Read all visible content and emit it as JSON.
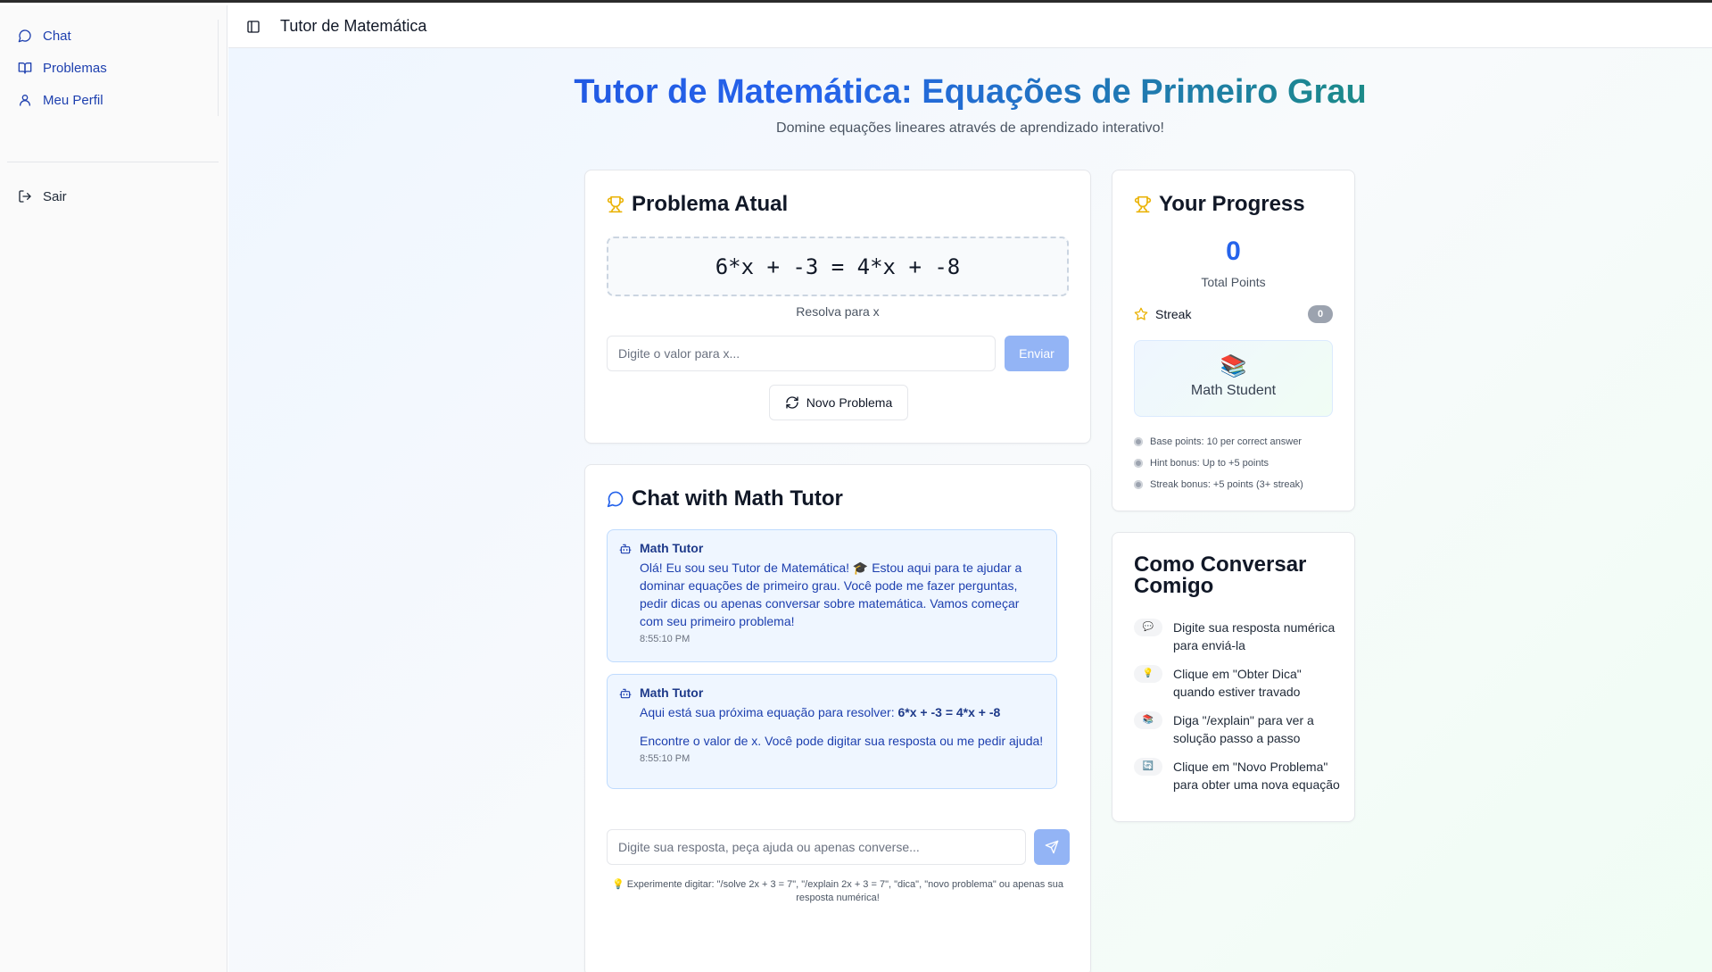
{
  "sidebar": {
    "items": [
      {
        "label": "Chat",
        "icon": "chat-bubble-icon"
      },
      {
        "label": "Problemas",
        "icon": "book-icon"
      },
      {
        "label": "Meu Perfil",
        "icon": "user-icon"
      }
    ],
    "logout": {
      "label": "Sair",
      "icon": "logout-icon"
    }
  },
  "header": {
    "title": "Tutor de Matemática"
  },
  "page": {
    "title": "Tutor de Matemática: Equações de Primeiro Grau",
    "subtitle": "Domine equações lineares através de aprendizado interativo!"
  },
  "problem": {
    "title": "Problema Atual",
    "equation": "6*x + -3 = 4*x + -8",
    "solve_for": "Resolva para x",
    "input_placeholder": "Digite o valor para x...",
    "send_label": "Enviar",
    "new_problem_label": "Novo Problema"
  },
  "chat": {
    "title": "Chat with Math Tutor",
    "messages": [
      {
        "sender": "Math Tutor",
        "text": "Olá! Eu sou seu Tutor de Matemática! 🎓 Estou aqui para te ajudar a dominar equações de primeiro grau. Você pode me fazer perguntas, pedir dicas ou apenas conversar sobre matemática. Vamos começar com seu primeiro problema!",
        "time": "8:55:10 PM"
      },
      {
        "sender": "Math Tutor",
        "text_prefix": "Aqui está sua próxima equação para resolver: ",
        "text_bold": "6*x + -3 = 4*x + -8",
        "text_line2": "Encontre o valor de x. Você pode digitar sua resposta ou me pedir ajuda!",
        "time": "8:55:10 PM"
      }
    ],
    "input_placeholder": "Digite sua resposta, peça ajuda ou apenas converse...",
    "tip": "💡 Experimente digitar: \"/solve 2x + 3 = 7\", \"/explain 2x + 3 = 7\", \"dica\", \"novo problema\" ou apenas sua resposta numérica!"
  },
  "progress": {
    "title": "Your Progress",
    "points": "0",
    "points_label": "Total Points",
    "streak_label": "Streak",
    "streak_value": "0",
    "level_emoji": "📚",
    "level_name": "Math Student",
    "rules": [
      "Base points: 10 per correct answer",
      "Hint bonus: Up to +5 points",
      "Streak bonus: +5 points (3+ streak)"
    ]
  },
  "howto": {
    "title": "Como Conversar Comigo",
    "items": [
      {
        "emoji": "💬",
        "text": "Digite sua resposta numérica para enviá-la"
      },
      {
        "emoji": "💡",
        "text": "Clique em \"Obter Dica\" quando estiver travado"
      },
      {
        "emoji": "📚",
        "text": "Diga \"/explain\" para ver a solução passo a passo"
      },
      {
        "emoji": "🔄",
        "text": "Clique em \"Novo Problema\" para obter uma nova equação"
      }
    ]
  },
  "colors": {
    "accent": "#2563eb",
    "accent_disabled": "#93b4f5",
    "title_gradient_end": "#16a34a",
    "trophy": "#eab308"
  }
}
